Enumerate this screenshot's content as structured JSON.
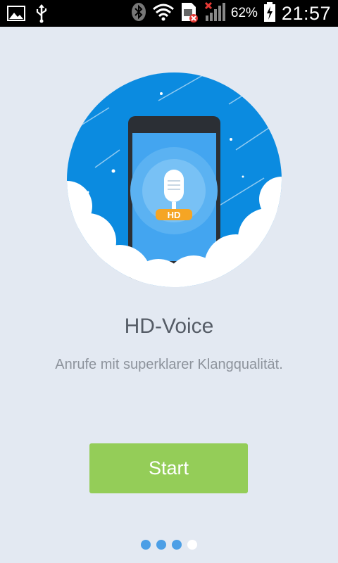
{
  "status_bar": {
    "battery_percent": "62%",
    "time": "21:57",
    "icons": [
      "image-icon",
      "usb-icon",
      "bluetooth-icon",
      "wifi-icon",
      "sim-error-icon",
      "signal-icon",
      "battery-icon"
    ]
  },
  "onboarding": {
    "badge": "HD",
    "title": "HD-Voice",
    "subtitle": "Anrufe mit superklarer Klangqualität.",
    "start_label": "Start",
    "page_count": 4,
    "active_page": 3
  },
  "colors": {
    "background": "#e3e9f2",
    "circle_blue": "#0b8be0",
    "button_green": "#94cd58",
    "dot_active": "#4c9fe6",
    "badge_orange": "#f5a524"
  }
}
